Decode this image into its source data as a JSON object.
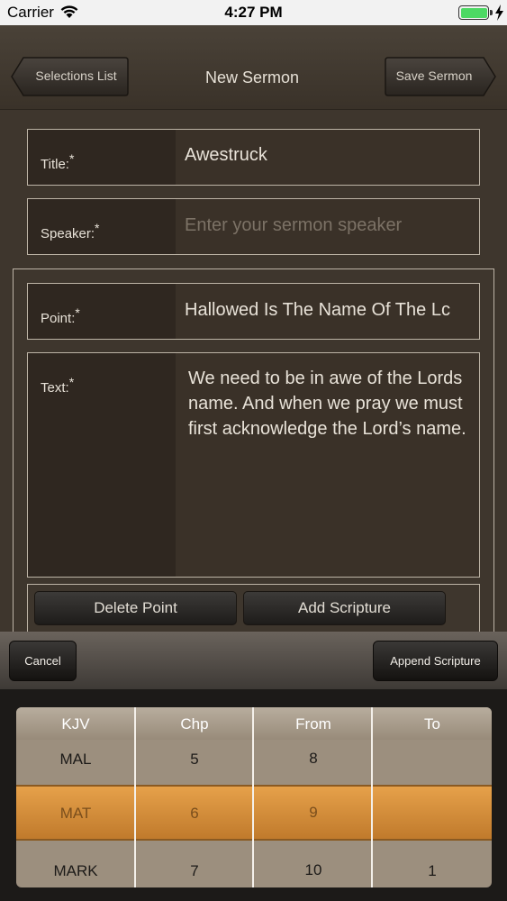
{
  "status": {
    "carrier": "Carrier",
    "time": "4:27 PM"
  },
  "nav": {
    "back_label": "Selections List",
    "title": "New Sermon",
    "save_label": "Save Sermon"
  },
  "form": {
    "title_label": "Title:",
    "title_value": "Awestruck",
    "speaker_label": "Speaker:",
    "speaker_placeholder": "Enter your sermon speaker",
    "required_marker": "*"
  },
  "point": {
    "point_label": "Point:",
    "point_value": "Hallowed Is The Name Of The Lc",
    "text_label": "Text:",
    "text_value": "We need to be in awe of the Lords name. And when we pray we must first acknowledge the Lord’s name.",
    "delete_label": "Delete Point",
    "add_scripture_label": "Add Scripture"
  },
  "toolbar": {
    "cancel_label": "Cancel",
    "append_label": "Append Scripture"
  },
  "picker": {
    "columns": [
      "KJV",
      "Chp",
      "From",
      "To"
    ],
    "rows": [
      {
        "book": "MAL",
        "chp": "5",
        "from": "8",
        "to": ""
      },
      {
        "book": "MAT",
        "chp": "6",
        "from": "9",
        "to": ""
      },
      {
        "book": "MARK",
        "chp": "7",
        "from": "10",
        "to": "1"
      }
    ]
  },
  "colors": {
    "background": "#3e362d",
    "selected_row": "#d8903c",
    "battery": "#4cd964"
  }
}
